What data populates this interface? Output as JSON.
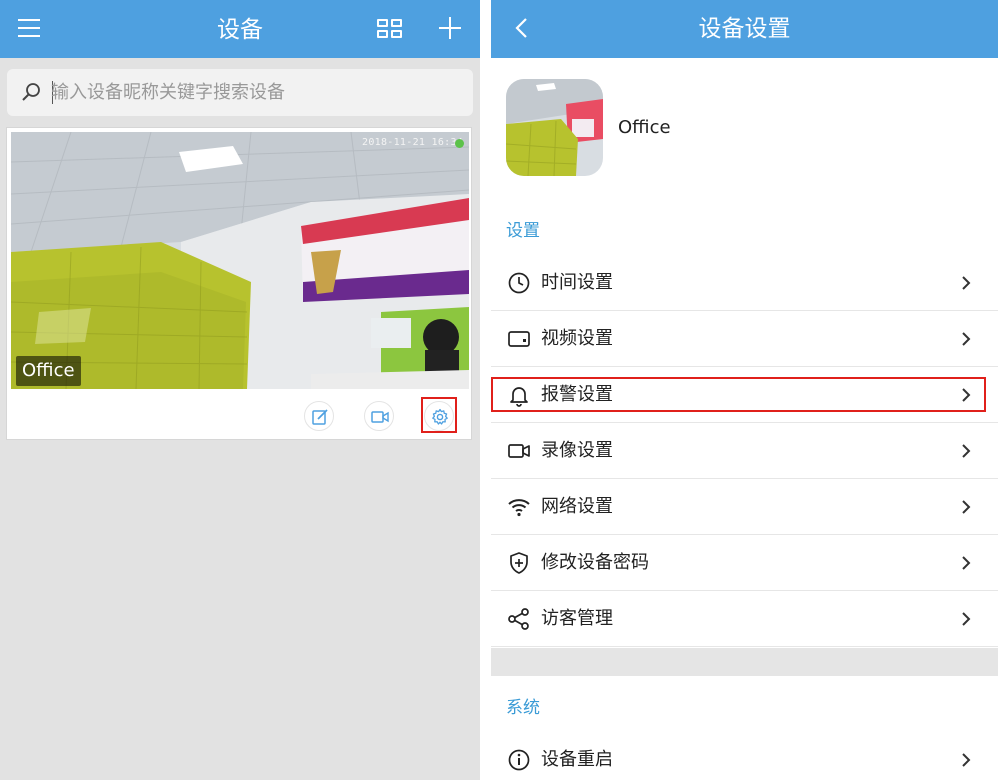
{
  "left": {
    "title": "设备",
    "search": {
      "placeholder": "输入设备昵称关键字搜索设备"
    },
    "device_card": {
      "name": "Office",
      "timestamp": "2018-11-21  16:34"
    }
  },
  "right": {
    "title": "设备设置",
    "device_name": "Office",
    "section_settings": "设置",
    "items": [
      {
        "label": "时间设置",
        "icon": "clock-icon"
      },
      {
        "label": "视频设置",
        "icon": "screen-icon"
      },
      {
        "label": "报警设置",
        "icon": "bell-icon"
      },
      {
        "label": "录像设置",
        "icon": "video-camera-icon"
      },
      {
        "label": "网络设置",
        "icon": "wifi-icon"
      },
      {
        "label": "修改设备密码",
        "icon": "shield-plus-icon"
      },
      {
        "label": "访客管理",
        "icon": "share-icon"
      }
    ],
    "section_system": "系统",
    "system_items": [
      {
        "label": "设备重启",
        "icon": "info-icon"
      }
    ]
  },
  "colors": {
    "header": "#4ea0e0",
    "section_title": "#3a9bd6",
    "highlight": "#e0201b"
  }
}
